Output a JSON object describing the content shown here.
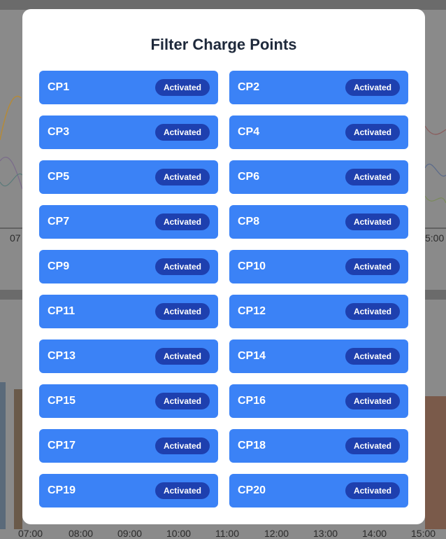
{
  "modal": {
    "title": "Filter Charge Points"
  },
  "charge_points": [
    {
      "label": "CP1",
      "status": "Activated"
    },
    {
      "label": "CP2",
      "status": "Activated"
    },
    {
      "label": "CP3",
      "status": "Activated"
    },
    {
      "label": "CP4",
      "status": "Activated"
    },
    {
      "label": "CP5",
      "status": "Activated"
    },
    {
      "label": "CP6",
      "status": "Activated"
    },
    {
      "label": "CP7",
      "status": "Activated"
    },
    {
      "label": "CP8",
      "status": "Activated"
    },
    {
      "label": "CP9",
      "status": "Activated"
    },
    {
      "label": "CP10",
      "status": "Activated"
    },
    {
      "label": "CP11",
      "status": "Activated"
    },
    {
      "label": "CP12",
      "status": "Activated"
    },
    {
      "label": "CP13",
      "status": "Activated"
    },
    {
      "label": "CP14",
      "status": "Activated"
    },
    {
      "label": "CP15",
      "status": "Activated"
    },
    {
      "label": "CP16",
      "status": "Activated"
    },
    {
      "label": "CP17",
      "status": "Activated"
    },
    {
      "label": "CP18",
      "status": "Activated"
    },
    {
      "label": "CP19",
      "status": "Activated"
    },
    {
      "label": "CP20",
      "status": "Activated"
    }
  ],
  "background": {
    "chart_time_labels": [
      "07",
      "5:00"
    ],
    "bottom_time_labels": [
      "07:00",
      "08:00",
      "09:00",
      "10:00",
      "11:00",
      "12:00",
      "13:00",
      "14:00",
      "15:00"
    ]
  },
  "colors": {
    "overlay": "#6b6b6b",
    "item_bg": "#3b82f6",
    "badge_bg": "#1e40af",
    "title": "#1e293b"
  }
}
